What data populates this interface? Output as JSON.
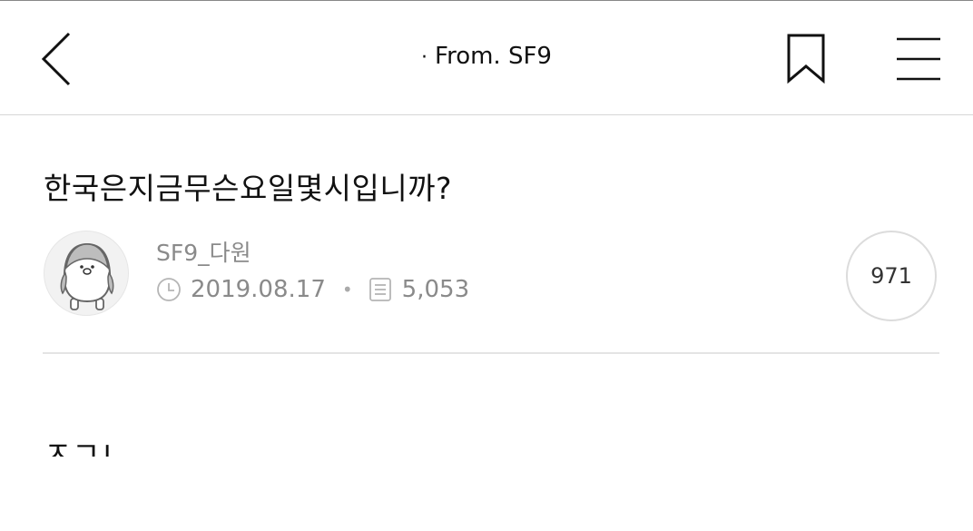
{
  "header": {
    "back_icon": "chevron-left-icon",
    "title_dot": "·",
    "title": "From. SF9",
    "bookmark_icon": "bookmark-icon",
    "menu_icon": "hamburger-menu-icon"
  },
  "post": {
    "title": "한국은지금무슨요일몇시입니까?",
    "author": "SF9_다원",
    "date": "2019.08.17",
    "separator": "•",
    "views": "5,053",
    "comment_count": "971",
    "body_text": "ㅈㄱㄴ"
  },
  "icons": {
    "avatar": "penguin-avatar",
    "clock": "clock-icon",
    "views": "document-icon"
  },
  "colors": {
    "text": "#111111",
    "muted": "#8a8a8a",
    "divider": "#e4e4e4"
  }
}
